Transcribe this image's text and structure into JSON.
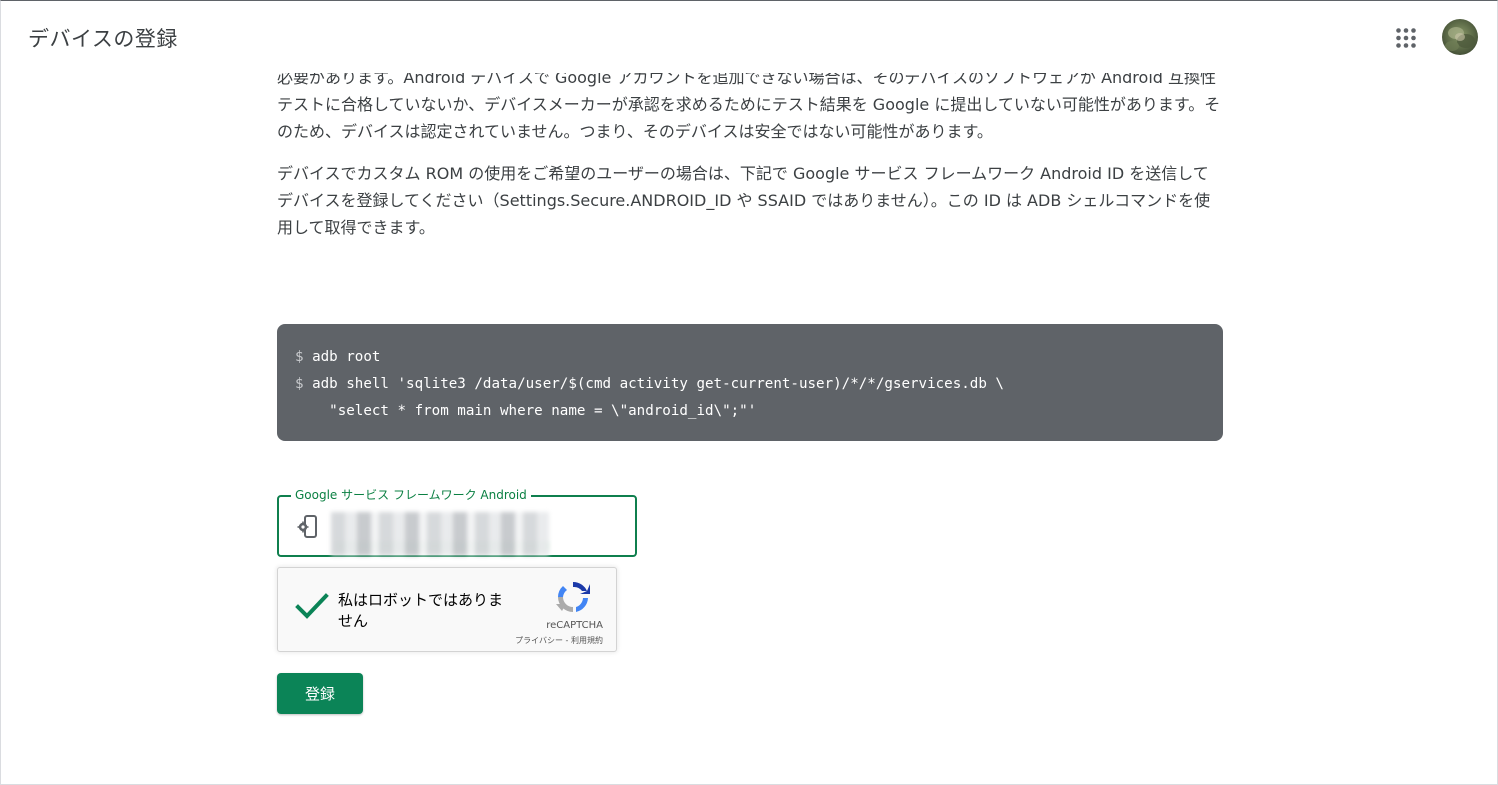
{
  "header": {
    "title": "デバイスの登録",
    "apps_icon": "grid-apps-icon",
    "avatar_icon": "user-avatar"
  },
  "content": {
    "paragraphs": [
      "必要があります。Android デバイスで Google アカウントを追加できない場合は、そのデバイスのソフトウェアが Android 互換性テストに合格していないか、デバイスメーカーが承認を求めるためにテスト結果を Google に提出していない可能性があります。そのため、デバイスは認定されていません。つまり、そのデバイスは安全ではない可能性があります。",
      "デバイスでカスタム ROM の使用をご希望のユーザーの場合は、下記で Google サービス フレームワーク Android ID を送信してデバイスを登録してください（Settings.Secure.ANDROID_ID や SSAID ではありません）。この ID は ADB シェルコマンドを使用して取得できます。"
    ],
    "code": {
      "prompt": "$",
      "lines": [
        "adb root",
        "adb shell 'sqlite3 /data/user/$(cmd activity get-current-user)/*/*/gservices.db \\",
        "\"select * from main where name = \\\"android_id\\\";\"'"
      ]
    }
  },
  "form": {
    "field_label": "Google サービス フレームワーク Android ID",
    "field_icon": "device-settings-icon",
    "field_value": "4",
    "recaptcha": {
      "label": "私はロボットではありません",
      "brand": "reCAPTCHA",
      "privacy": "プライバシー",
      "separator": " - ",
      "terms": "利用規約",
      "checked": true
    },
    "submit_label": "登録"
  },
  "colors": {
    "accent": "#0b8457",
    "code_bg": "#5f6368",
    "check": "#0b8457"
  }
}
